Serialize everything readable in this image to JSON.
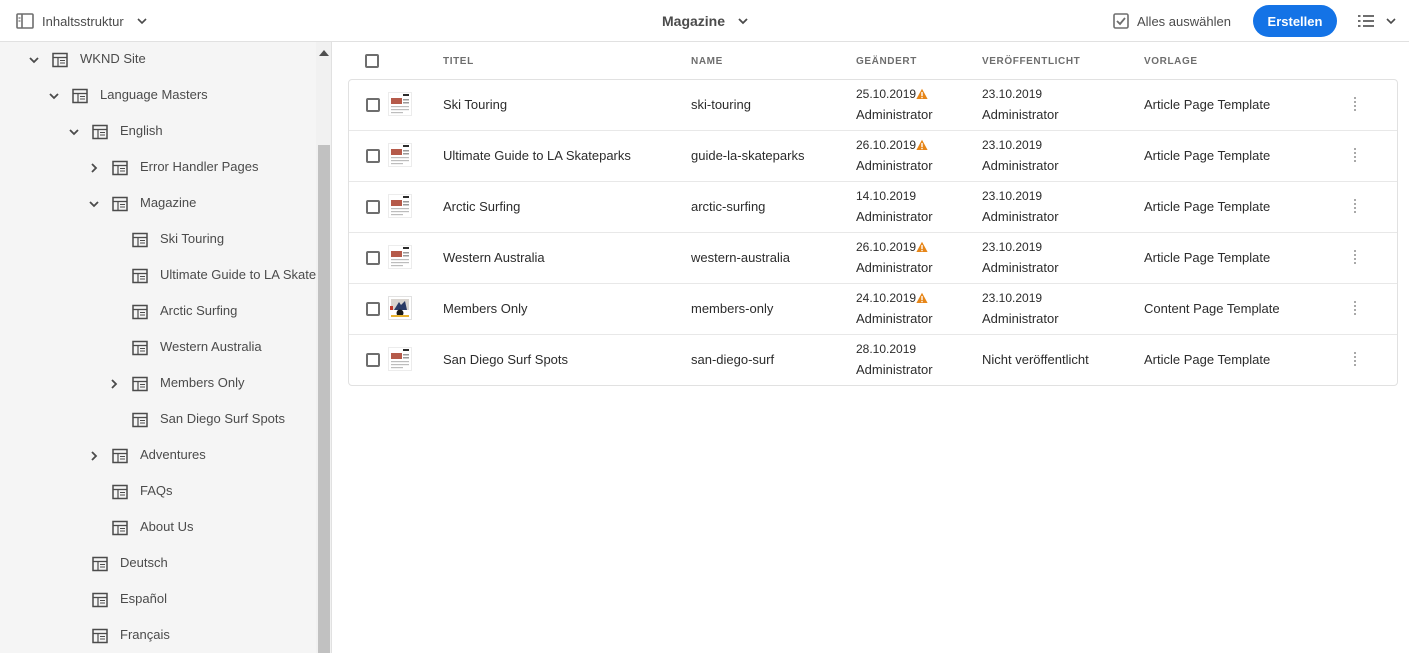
{
  "topbar": {
    "rail_label": "Inhaltsstruktur",
    "breadcrumb": "Magazine",
    "select_all": "Alles auswählen",
    "create": "Erstellen"
  },
  "tree": [
    {
      "label": "WKND Site",
      "level": 0,
      "state": "expanded"
    },
    {
      "label": "Language Masters",
      "level": 1,
      "state": "expanded"
    },
    {
      "label": "English",
      "level": 2,
      "state": "expanded"
    },
    {
      "label": "Error Handler Pages",
      "level": 3,
      "state": "collapsed"
    },
    {
      "label": "Magazine",
      "level": 3,
      "state": "expanded"
    },
    {
      "label": "Ski Touring",
      "level": 4,
      "state": "leaf"
    },
    {
      "label": "Ultimate Guide to LA Skatepa",
      "level": 4,
      "state": "leaf"
    },
    {
      "label": "Arctic Surfing",
      "level": 4,
      "state": "leaf"
    },
    {
      "label": "Western Australia",
      "level": 4,
      "state": "leaf"
    },
    {
      "label": "Members Only",
      "level": 4,
      "state": "collapsed"
    },
    {
      "label": "San Diego Surf Spots",
      "level": 4,
      "state": "leaf"
    },
    {
      "label": "Adventures",
      "level": 3,
      "state": "collapsed"
    },
    {
      "label": "FAQs",
      "level": 3,
      "state": "leaf"
    },
    {
      "label": "About Us",
      "level": 3,
      "state": "leaf"
    },
    {
      "label": "Deutsch",
      "level": 2,
      "state": "leaf"
    },
    {
      "label": "Español",
      "level": 2,
      "state": "leaf"
    },
    {
      "label": "Français",
      "level": 2,
      "state": "leaf"
    }
  ],
  "table": {
    "headers": {
      "title": "TITEL",
      "name": "NAME",
      "modified": "GEÄNDERT",
      "published": "VERÖFFENTLICHT",
      "template": "VORLAGE"
    },
    "rows": [
      {
        "title": "Ski Touring",
        "name": "ski-touring",
        "modified_date": "25.10.2019",
        "modified_by": "Administrator",
        "warning": true,
        "published_date": "23.10.2019",
        "published_by": "Administrator",
        "template": "Article Page Template",
        "thumb": "article"
      },
      {
        "title": "Ultimate Guide to LA Skateparks",
        "name": "guide-la-skateparks",
        "modified_date": "26.10.2019",
        "modified_by": "Administrator",
        "warning": true,
        "published_date": "23.10.2019",
        "published_by": "Administrator",
        "template": "Article Page Template",
        "thumb": "article"
      },
      {
        "title": "Arctic Surfing",
        "name": "arctic-surfing",
        "modified_date": "14.10.2019",
        "modified_by": "Administrator",
        "warning": false,
        "published_date": "23.10.2019",
        "published_by": "Administrator",
        "template": "Article Page Template",
        "thumb": "article"
      },
      {
        "title": "Western Australia",
        "name": "western-australia",
        "modified_date": "26.10.2019",
        "modified_by": "Administrator",
        "warning": true,
        "published_date": "23.10.2019",
        "published_by": "Administrator",
        "template": "Article Page Template",
        "thumb": "article"
      },
      {
        "title": "Members Only",
        "name": "members-only",
        "modified_date": "24.10.2019",
        "modified_by": "Administrator",
        "warning": true,
        "published_date": "23.10.2019",
        "published_by": "Administrator",
        "template": "Content Page Template",
        "thumb": "content"
      },
      {
        "title": "San Diego Surf Spots",
        "name": "san-diego-surf",
        "modified_date": "28.10.2019",
        "modified_by": "Administrator",
        "warning": false,
        "published_date": "",
        "published_by": "",
        "published_status": "Nicht veröffentlicht",
        "template": "Article Page Template",
        "thumb": "article"
      }
    ]
  },
  "colors": {
    "accent": "#1473e6",
    "warning": "#e68619",
    "rail_bg": "#f5f5f5"
  },
  "icons": {
    "rail_toggle": "rail-icon",
    "breadcrumb_dropdown": "chevron-down-icon",
    "select_all": "checkbox-checked-icon",
    "view_switch": "list-view-icon",
    "tree_page": "page-icon",
    "tree_expand": "chevron-right-icon",
    "tree_collapse": "chevron-down-icon",
    "row_warning": "alert-icon",
    "row_more": "more-vertical-icon"
  }
}
